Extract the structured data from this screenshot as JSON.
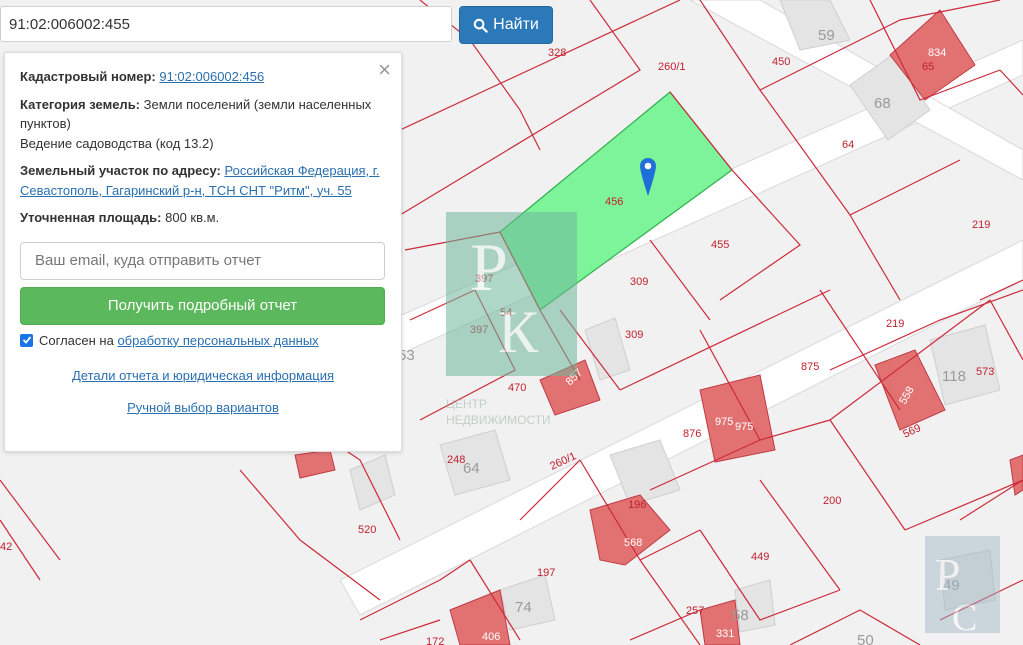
{
  "search": {
    "value": "91:02:006002:455",
    "button_label": "Найти"
  },
  "panel": {
    "cadastral_label": "Кадастровый номер:",
    "cadastral_value": "91:02:006002:456",
    "category_label": "Категория земель:",
    "category_value": "Земли поселений (земли населенных пунктов)",
    "usage": "Ведение садоводства (код 13.2)",
    "address_label": "Земельный участок по адресу:",
    "address_value": "Российская Федерация, г. Севастополь, Гагаринский р-н, ТСН СНТ \"Ритм\", уч. 55",
    "area_label": "Уточненная площадь:",
    "area_value": "800 кв.м.",
    "email_placeholder": "Ваш email, куда отправить отчет",
    "report_button": "Получить подробный отчет",
    "agree_text": "Согласен на",
    "agree_link": "обработку персональных данных",
    "details_link": "Детали отчета и юридическая информация",
    "manual_link": "Ручной выбор вариантов"
  },
  "map": {
    "parcel_labels": [
      "328",
      "260/1",
      "450",
      "59",
      "834",
      "65",
      "68",
      "64",
      "219",
      "456",
      "455",
      "397",
      "309",
      "397",
      "54",
      "309",
      "219",
      "875",
      "573",
      "118",
      "470",
      "857",
      "53",
      "558",
      "569",
      "975",
      "975",
      "876",
      "248",
      "64",
      "260/1",
      "196",
      "200",
      "520",
      "568",
      "449",
      "42",
      "197",
      "74",
      "257",
      "58",
      "49",
      "172",
      "406",
      "331",
      "50"
    ],
    "watermark_text": "ЦЕНТР НЕДВИЖИМОСТИ",
    "colors": {
      "selected_parcel": "#7ef49a",
      "building_cadastral": "#e07070",
      "building_gray": "#e6e6e6",
      "parcel_border": "#cc2a3a",
      "marker": "#1e6fd9"
    }
  }
}
